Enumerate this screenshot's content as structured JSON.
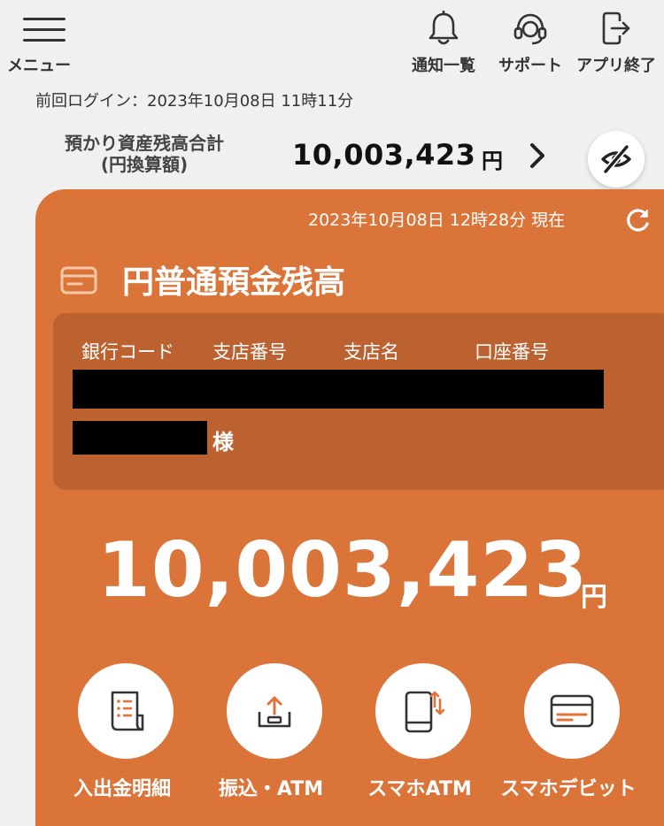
{
  "header": {
    "menu_label": "メニュー",
    "notifications_label": "通知一覧",
    "support_label": "サポート",
    "exit_label": "アプリ終了"
  },
  "last_login": "前回ログイン：2023年10月08日 11時11分",
  "summary": {
    "label_line1": "預かり資産残高合計",
    "label_line2": "(円換算額)",
    "amount": "10,003,423",
    "unit": "円"
  },
  "card": {
    "as_of": "2023年10月08日 12時28分 現在",
    "title": "円普通預金残高",
    "account_headers": [
      "銀行コード",
      "支店番号",
      "支店名",
      "口座番号"
    ],
    "honorific": "様",
    "balance": "10,003,423",
    "unit": "円"
  },
  "actions": [
    {
      "label": "入出金明細",
      "icon": "statement-icon"
    },
    {
      "label": "振込・ATM",
      "icon": "transfer-icon"
    },
    {
      "label": "スマホATM",
      "icon": "phone-atm-icon"
    },
    {
      "label": "スマホデビット",
      "icon": "debit-card-icon"
    }
  ],
  "colors": {
    "background": "#f0f0f0",
    "accent_orange": "#da7439",
    "account_box": "#bc6230",
    "redaction": "#000000"
  }
}
